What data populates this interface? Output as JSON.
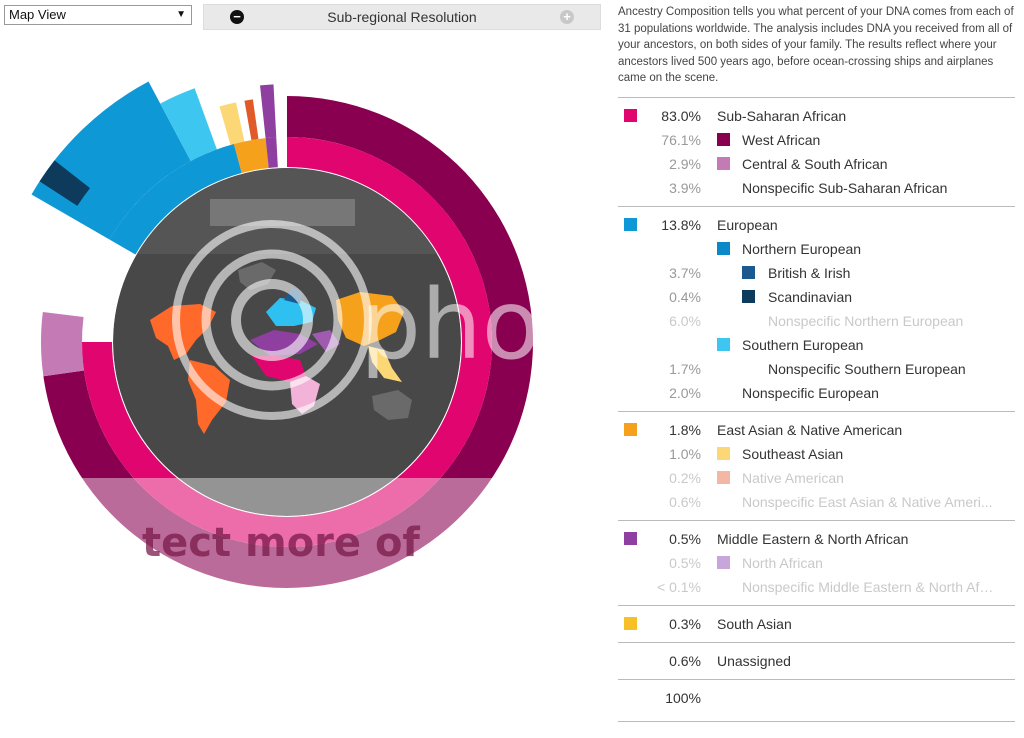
{
  "toolbar": {
    "view_select": "Map View",
    "resolution_label": "Sub-regional Resolution"
  },
  "description": "Ancestry Composition tells you what percent of your DNA comes from each of 31 populations worldwide. The analysis includes DNA you received from all of your ancestors, on both sides of your family. The results reflect where your ancestors lived 500 years ago, before ocean-crossing ships and airplanes came on the scene.",
  "watermark": {
    "text": "photo",
    "banner_text": "tect more of"
  },
  "legend": {
    "groups": [
      {
        "pct": "83.0%",
        "label": "Sub-Saharan African",
        "color": "#e0056f",
        "items": [
          {
            "pct": "76.1%",
            "label": "West African",
            "color": "#8a0050",
            "level": 1
          },
          {
            "pct": "2.9%",
            "label": "Central & South African",
            "color": "#c47bb5",
            "level": 1
          },
          {
            "pct": "3.9%",
            "label": "Nonspecific Sub-Saharan African",
            "color": "",
            "level": 1
          }
        ]
      },
      {
        "pct": "13.8%",
        "label": "European",
        "color": "#0f98d6",
        "items": [
          {
            "pct": "",
            "label": "Northern European",
            "color": "#0a88c8",
            "level": 1
          },
          {
            "pct": "3.7%",
            "label": "British & Irish",
            "color": "#1a5a8e",
            "level": 2
          },
          {
            "pct": "0.4%",
            "label": "Scandinavian",
            "color": "#0e3a5c",
            "level": 2
          },
          {
            "pct": "6.0%",
            "label": "Nonspecific Northern European",
            "color": "",
            "level": 2
          },
          {
            "pct": "",
            "label": "Southern European",
            "color": "#3dc6ef",
            "level": 1
          },
          {
            "pct": "1.7%",
            "label": "Nonspecific Southern European",
            "color": "",
            "level": 2
          },
          {
            "pct": "2.0%",
            "label": "Nonspecific European",
            "color": "",
            "level": 1
          }
        ]
      },
      {
        "pct": "1.8%",
        "label": "East Asian & Native American",
        "color": "#f6a11c",
        "items": [
          {
            "pct": "1.0%",
            "label": "Southeast Asian",
            "color": "#fcd776",
            "level": 1
          },
          {
            "pct": "0.2%",
            "label": "Native American",
            "color": "#f4b7a4",
            "level": 1
          },
          {
            "pct": "0.6%",
            "label": "Nonspecific East Asian & Native Ameri...",
            "color": "",
            "level": 1
          }
        ]
      },
      {
        "pct": "0.5%",
        "label": "Middle Eastern & North African",
        "color": "#8e3fa0",
        "items": [
          {
            "pct": "0.5%",
            "label": "North African",
            "color": "#c8a6dc",
            "level": 1
          },
          {
            "pct": "< 0.1%",
            "label": "Nonspecific Middle Eastern & North Afri...",
            "color": "",
            "level": 1
          }
        ]
      },
      {
        "pct": "0.3%",
        "label": "South Asian",
        "color": "#f6c026",
        "items": []
      },
      {
        "pct": "0.6%",
        "label": "Unassigned",
        "color": "",
        "items": []
      }
    ],
    "total": "100%"
  },
  "colors": {
    "west_african": "#8a0050",
    "sub_saharan": "#e0056f",
    "central_south_african": "#c47bb5",
    "european": "#0f98d6",
    "british_irish": "#1a5a8e",
    "scandinavian": "#0e3a5c",
    "southern_european": "#3dc6ef",
    "east_asian": "#f6a11c",
    "southeast_asian": "#fcd776",
    "middle_eastern": "#8e3fa0",
    "map_bg": "#484848",
    "land": "#6a6a6a"
  }
}
